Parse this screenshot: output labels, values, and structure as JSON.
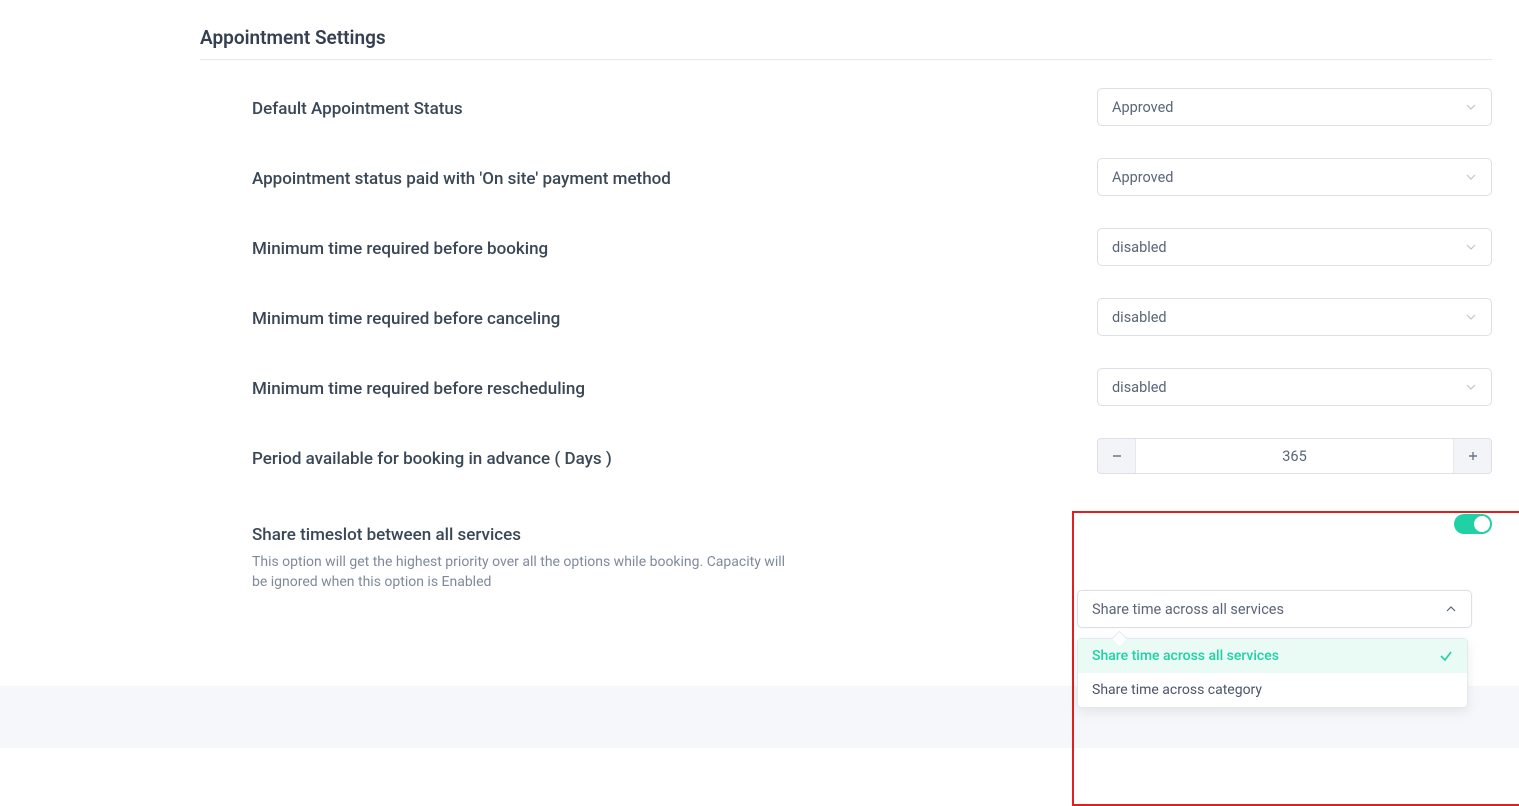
{
  "section_title": "Appointment Settings",
  "fields": {
    "default_status": {
      "label": "Default Appointment Status",
      "value": "Approved"
    },
    "onsite_status": {
      "label": "Appointment status paid with 'On site' payment method",
      "value": "Approved"
    },
    "min_before_booking": {
      "label": "Minimum time required before booking",
      "value": "disabled"
    },
    "min_before_canceling": {
      "label": "Minimum time required before canceling",
      "value": "disabled"
    },
    "min_before_rescheduling": {
      "label": "Minimum time required before rescheduling",
      "value": "disabled"
    },
    "booking_advance": {
      "label": "Period available for booking in advance ( Days )",
      "value": "365"
    },
    "share_timeslot": {
      "label": "Share timeslot between all services",
      "hint": "This option will get the highest priority over all the options while booking. Capacity will be ignored when this option is Enabled",
      "toggle": true,
      "select_value": "Share time across all services",
      "options": [
        {
          "label": "Share time across all services",
          "selected": true
        },
        {
          "label": "Share time across category",
          "selected": false
        }
      ]
    }
  }
}
